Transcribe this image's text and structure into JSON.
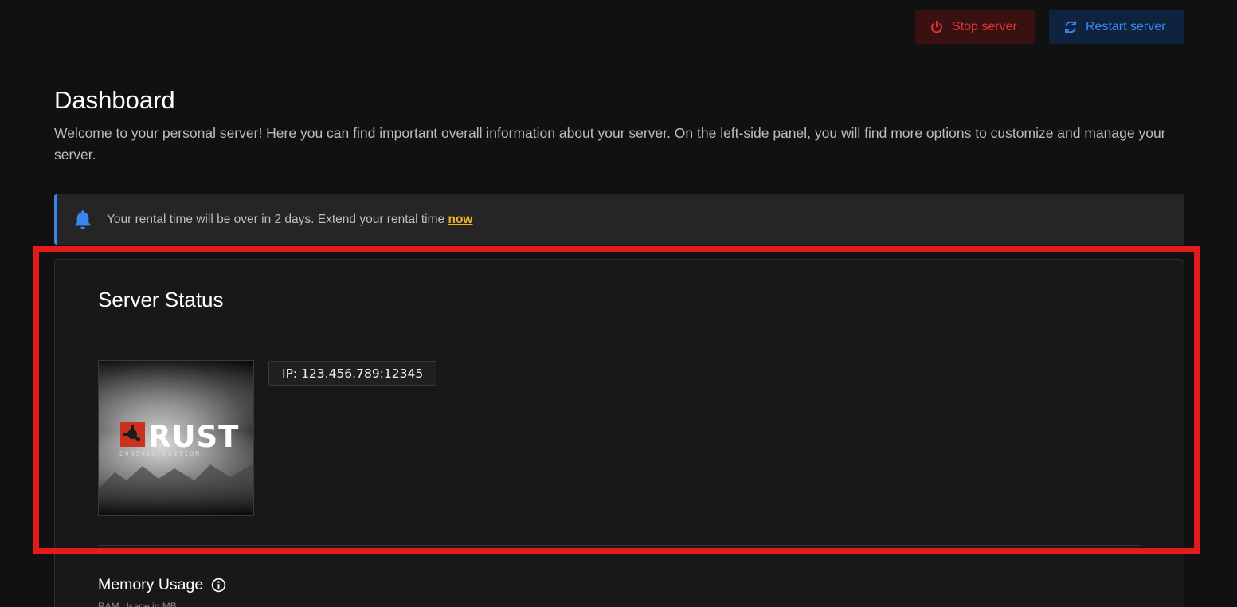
{
  "header": {
    "stop_label": "Stop server",
    "restart_label": "Restart server"
  },
  "page": {
    "title": "Dashboard",
    "intro": "Welcome to your personal server! Here you can find important overall information about your server. On the left-side panel, you will find more options to customize and manage your server."
  },
  "alert": {
    "message": "Your rental time will be over in 2 days. Extend your rental time",
    "link_label": "now",
    "icon": "bell-icon"
  },
  "server_status": {
    "title": "Server Status",
    "ip": "IP: 123.456.789:12345",
    "game_logo_text": "RUST",
    "game_logo_subtext": "CONSOLE EDITION"
  },
  "memory": {
    "title": "Memory Usage",
    "subtitle": "RAM Usage in MB"
  },
  "colors": {
    "background": "#111111",
    "stop": "#e53535",
    "restart": "#3d86f0",
    "link": "#f0b429",
    "highlight": "#e21b1b"
  }
}
